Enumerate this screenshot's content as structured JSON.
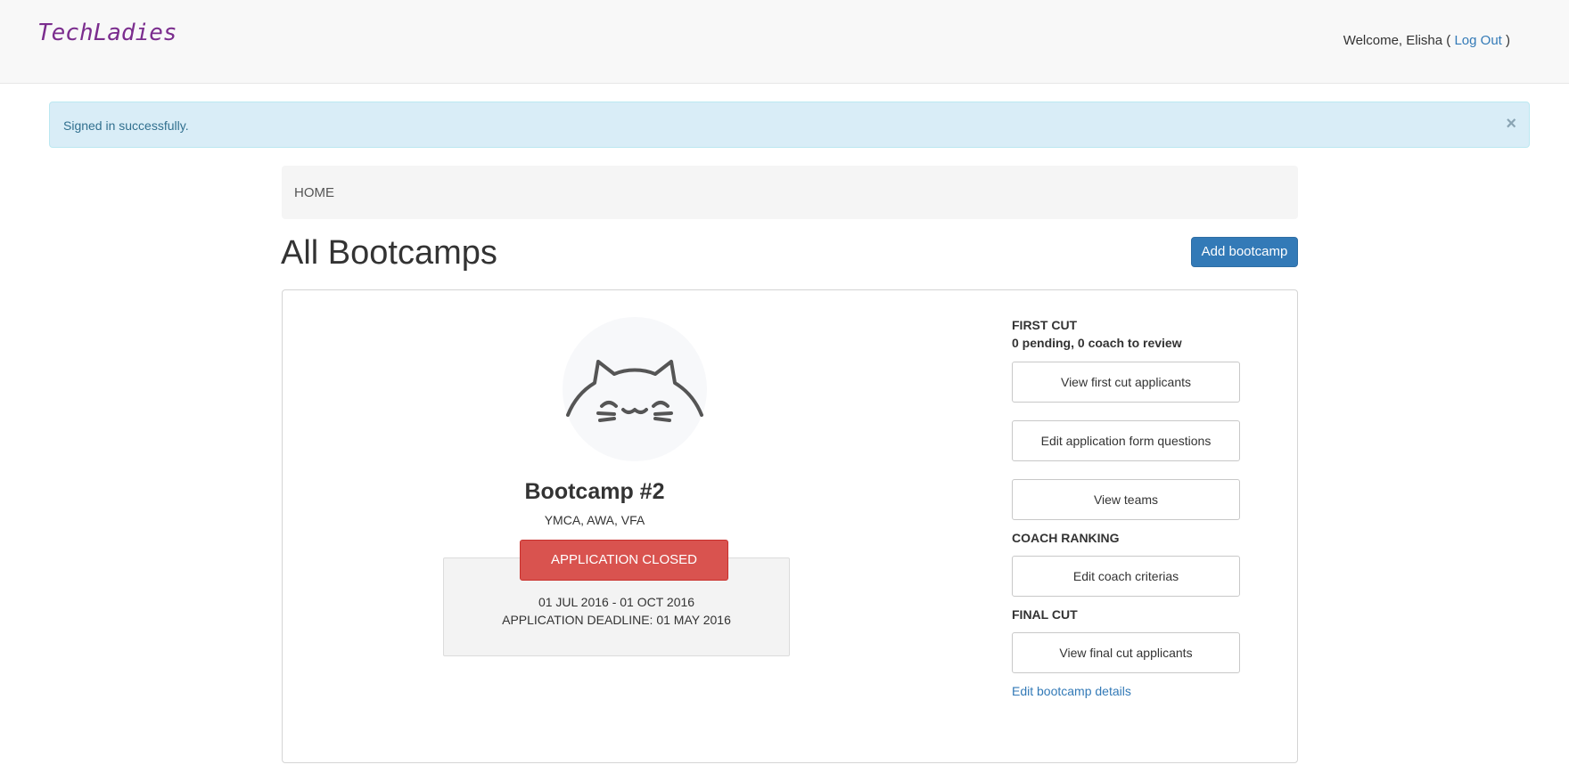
{
  "navbar": {
    "brand": "TechLadies",
    "welcome_prefix": "Welcome, Elisha (",
    "logout_label": "Log Out",
    "welcome_suffix": ")"
  },
  "alert": {
    "message": "Signed in successfully.",
    "close_glyph": "×"
  },
  "breadcrumb": {
    "home": "HOME"
  },
  "page": {
    "title": "All Bootcamps",
    "add_button": "Add bootcamp"
  },
  "bootcamp": {
    "name": "Bootcamp #2",
    "organizations": "YMCA, AWA, VFA",
    "status": "APPLICATION CLOSED",
    "status_color": "#d9534f",
    "date_range": "01 JUL 2016 - 01 OCT 2016",
    "deadline": "APPLICATION DEADLINE: 01 MAY 2016",
    "avatar_icon": "cat-face-icon"
  },
  "actions": {
    "first_cut_label": "FIRST CUT",
    "first_cut_summary": "0 pending, 0 coach to review",
    "view_first_cut": "View first cut applicants",
    "edit_form_questions": "Edit application form questions",
    "view_teams": "View teams",
    "coach_ranking_label": "COACH RANKING",
    "edit_coach_criterias": "Edit coach criterias",
    "final_cut_label": "FINAL CUT",
    "view_final_cut": "View final cut applicants",
    "edit_details_link": "Edit bootcamp details"
  },
  "colors": {
    "brand": "#7b2d8e",
    "primary": "#337ab7",
    "alert_bg": "#d9edf7"
  }
}
